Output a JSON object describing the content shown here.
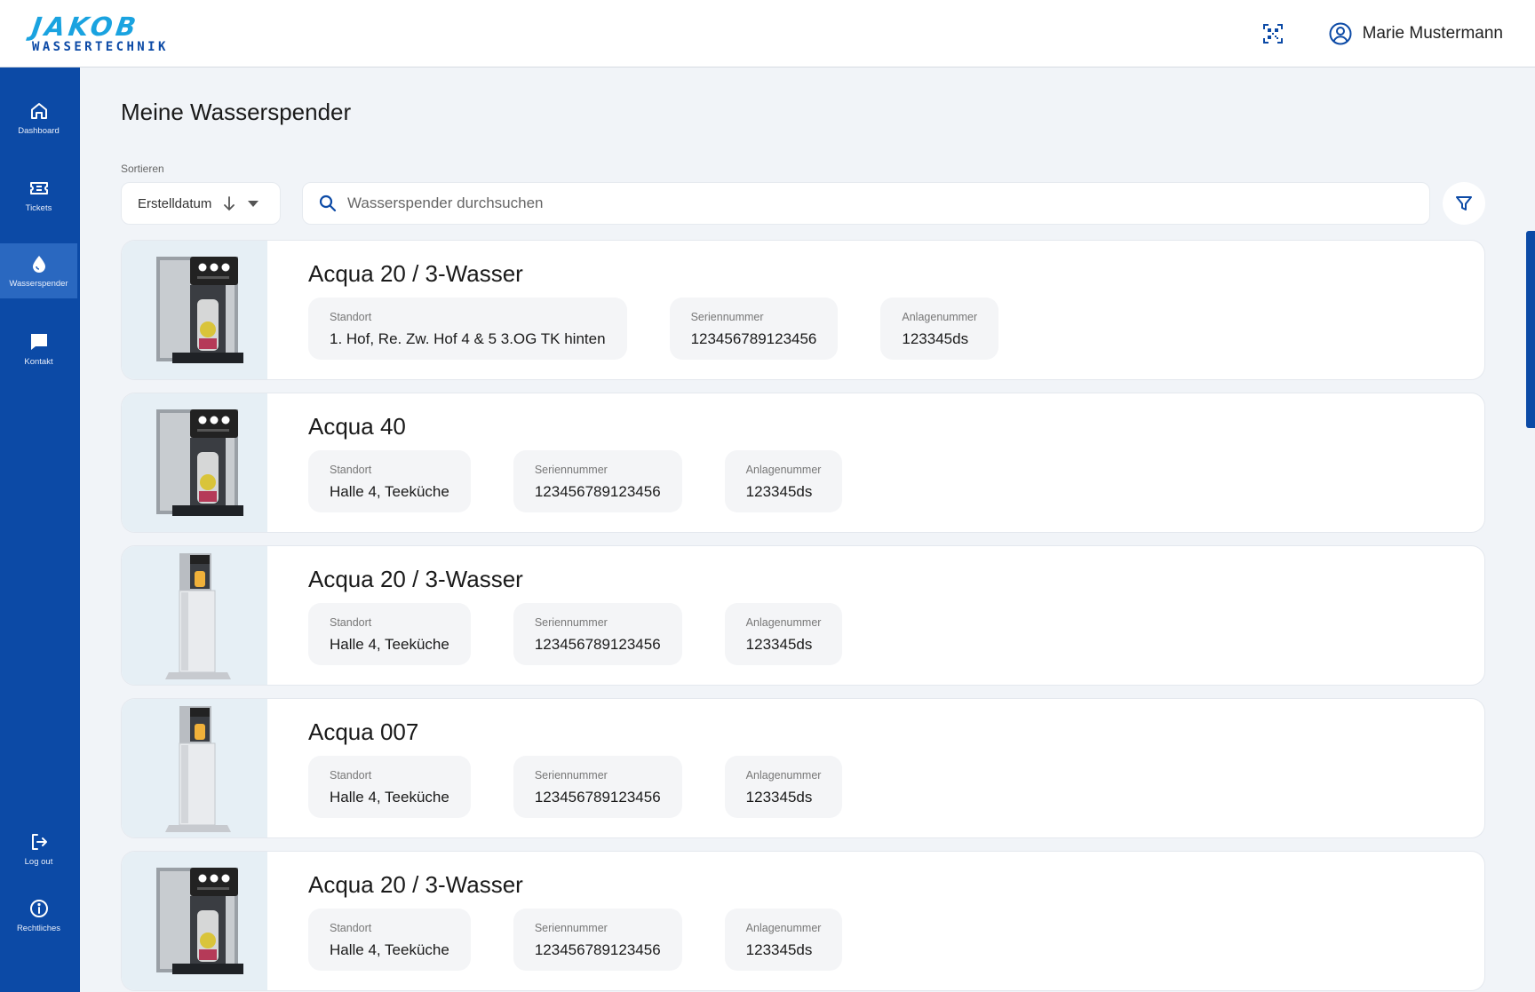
{
  "brand": {
    "name": "JAKOB",
    "subtitle": "WASSERTECHNIK",
    "color": "#1aa3e0",
    "sub_color": "#0c4aa6"
  },
  "header": {
    "user_name": "Marie Mustermann",
    "qr_icon": "qr-code-icon",
    "user_icon": "user-circle-icon"
  },
  "sidebar": {
    "color": "#0c4aa6",
    "items": [
      {
        "label": "Dashboard",
        "icon": "home-icon"
      },
      {
        "label": "Tickets",
        "icon": "ticket-icon"
      },
      {
        "label": "Wasserspender",
        "icon": "water-drop-icon",
        "active": true
      },
      {
        "label": "Kontakt",
        "icon": "chat-icon"
      },
      {
        "label": "Log out",
        "icon": "logout-icon"
      },
      {
        "label": "Rechtliches",
        "icon": "info-icon"
      }
    ]
  },
  "main": {
    "title": "Meine Wasserspender",
    "sort": {
      "label": "Sortieren",
      "value": "Erstelldatum"
    },
    "search": {
      "placeholder": "Wasserspender durchsuchen"
    },
    "field_labels": {
      "location": "Standort",
      "serial": "Seriennummer",
      "plant": "Anlagenummer"
    },
    "dispensers": [
      {
        "name": "Acqua 20 / 3-Wasser",
        "location": "1. Hof, Re. Zw. Hof 4 & 5 3.OG TK hinten",
        "serial": "123456789123456",
        "plant": "123345ds",
        "image": "countertop-dispenser"
      },
      {
        "name": "Acqua 40",
        "location": "Halle 4, Teeküche",
        "serial": "123456789123456",
        "plant": "123345ds",
        "image": "countertop-dispenser"
      },
      {
        "name": "Acqua 20 / 3-Wasser",
        "location": "Halle 4, Teeküche",
        "serial": "123456789123456",
        "plant": "123345ds",
        "image": "floor-dispenser"
      },
      {
        "name": "Acqua 007",
        "location": "Halle 4, Teeküche",
        "serial": "123456789123456",
        "plant": "123345ds",
        "image": "floor-dispenser"
      },
      {
        "name": "Acqua 20 / 3-Wasser",
        "location": "Halle 4, Teeküche",
        "serial": "123456789123456",
        "plant": "123345ds",
        "image": "countertop-dispenser"
      }
    ]
  }
}
